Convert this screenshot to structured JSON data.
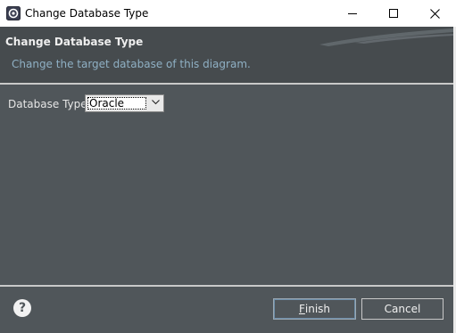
{
  "window": {
    "title": "Change Database Type",
    "icon": "eclipse-app-icon",
    "controls": [
      "minimize-icon",
      "maximize-icon",
      "close-icon"
    ]
  },
  "banner": {
    "title": "Change Database Type",
    "description": "Change the target database of this diagram."
  },
  "form": {
    "database_type_label": "Database Type:",
    "database_type_value": "Oracle"
  },
  "footer": {
    "help_icon": "question-circle-icon",
    "finish_mnemonic": "F",
    "finish_rest": "inish",
    "cancel_label": "Cancel"
  },
  "colors": {
    "banner_bg": "#464b4e",
    "content_bg": "#50565a",
    "description_text": "#8fb0c4",
    "finish_focus_border": "#6d8da8"
  }
}
